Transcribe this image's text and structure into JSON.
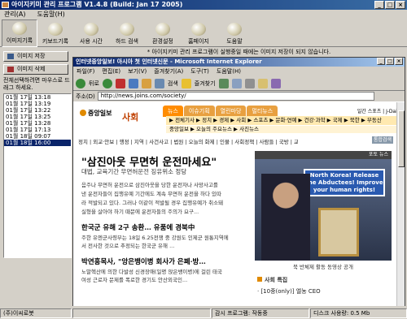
{
  "window": {
    "title": "아이지키미 관리 프로그램 V1.4.8 (Build: Jan 17 2005)"
  },
  "menu": [
    "관리(A)",
    "도움말(H)"
  ],
  "toolbar": [
    {
      "label": "이미지기록",
      "icon": "image-record-icon"
    },
    {
      "label": "키보드기록",
      "icon": "keyboard-icon"
    },
    {
      "label": "사용 시간",
      "icon": "clock-icon"
    },
    {
      "label": "하드 검색",
      "icon": "search-icon"
    },
    {
      "label": "환경설정",
      "icon": "settings-icon"
    },
    {
      "label": "홈페이지",
      "icon": "home-icon"
    },
    {
      "label": "도움말",
      "icon": "help-icon"
    }
  ],
  "left": {
    "save_button": "이미지 저장",
    "delete_button": "이미지 삭제",
    "hint": "전체선택하려면 마우스로 드래그 하세요.",
    "times": [
      "01월 17일 13:18",
      "01월 17일 13:19",
      "01월 17일 13:22",
      "01월 17일 13:25",
      "01월 17일 13:28",
      "01월 17일 17:13",
      "01월 18일 09:07",
      "01월 18일 16:00"
    ],
    "selected_index": 7
  },
  "notice": "* 아이지키미 관리 프로그램이 실행중일 때에는 이미지 저장이 되지 않습니다.",
  "ie": {
    "title": "인터넷중앙일보! 아시아 첫 인터넷신문 - Microsoft Internet Explorer",
    "menu": [
      "파일(F)",
      "편집(E)",
      "보기(V)",
      "즐겨찾기(A)",
      "도구(T)",
      "도움말(H)"
    ],
    "back": "뒤로",
    "search": "검색",
    "favorites": "즐겨찾기",
    "address_label": "주소(D)",
    "address": "http://news.joins.com/society/"
  },
  "page": {
    "logo": "중앙일보",
    "section": "사회",
    "tabs": [
      "뉴스",
      "이슈기획",
      "열린마당",
      "멀티뉴스"
    ],
    "top_right": "일간 스포츠 | J-Daily",
    "subnav": "▶ 전체기사 ▶ 정치 ▶ 경제 ▶ 사회 ▶ 스포츠 ▶ 문화·연예 ▶ 건강·과학 ▶ 국제 ▶ 북한 ▶ 부동산",
    "subnav2": "중앙일보 ▶ 오늘의 주요뉴스 ▶ 사진뉴스",
    "category_line": "정치 | 외교·안보 | 행정 | 지역 | 사건사고 | 법원 | 오늘의 화제 | 인물 | 사회정책 | 사람들 | 국방 | 교육",
    "search_button": "통합검색",
    "headline": "\"삼진아웃 무면허 운전마세요\"",
    "subhead": "대법, 교육기간 무면허운전 징유위소 정당",
    "body": [
      "음주나 무면허 운전으로 삼진아웃을 당한 운전자나 사망사고를",
      "낸 운전자들이 집행유예 기간에도 계속 무면허 운전을 하다 있따",
      "라 적발되고 있다. 그러나 이같이 적발될 경우 집행유예가 취소돼",
      "실형을 살아야 하기 때문에 운전자들의 주의가 요구..."
    ],
    "story2_title": "한국군 유해 2구 송환… 유품에 경북中",
    "story2_body": [
      "주한 유엔군사령부는 18일 6.25전쟁 중 강원도 인제군 원통지역에",
      "서 전사한 것으로 추정되는 한국군 유해 ..."
    ],
    "story3_title": "박연흥목사, \"앙은뱅이병 회사가 은폐·방…",
    "story3_body": [
      "노말헥산에 의한 다발성 신경장애(일명 앉은뱅이병)에 걸린 태국",
      "여성 근로자 문제를 폭로한 경기도 안산외국인..."
    ],
    "photo_header": "포토 뉴스",
    "photo_sign": "North Korea! Release the Abductees! Improve your human rights!",
    "photo_caption": "북 반체제 활동 동영상 공개",
    "related_title": "사회 특집",
    "related_item": "· [10중(only)] 엘농 CEO"
  },
  "status": {
    "company": "(주)이씨로봇",
    "monitor": "감시 프로그램: 작동중",
    "disk": "디스크 사용량: 0.5 Mb"
  }
}
